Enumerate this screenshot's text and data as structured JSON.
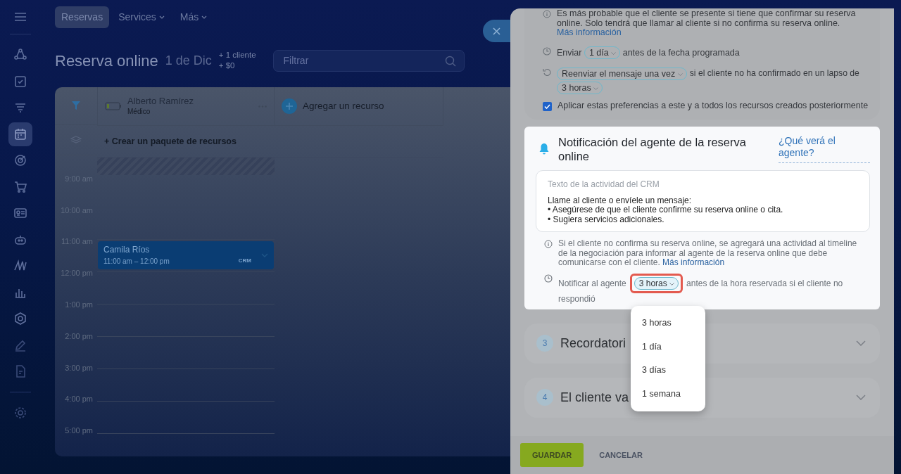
{
  "sidebar": {
    "items": [
      {
        "selected": false
      },
      {
        "selected": false
      },
      {
        "selected": false
      },
      {
        "selected": true
      },
      {
        "selected": false
      },
      {
        "selected": false
      },
      {
        "selected": false
      },
      {
        "selected": false
      },
      {
        "selected": false
      },
      {
        "selected": false
      },
      {
        "selected": false
      },
      {
        "selected": false
      },
      {
        "selected": false
      },
      {
        "selected": false
      }
    ]
  },
  "top_nav": [
    {
      "label": "Reservas",
      "selected": true,
      "has_menu": false
    },
    {
      "label": "Services",
      "selected": false,
      "has_menu": true
    },
    {
      "label": "Más",
      "selected": false,
      "has_menu": true
    }
  ],
  "header": {
    "title": "Reserva online",
    "date": "1 de Dic",
    "stats": [
      "+ 1 cliente",
      "+ $0"
    ],
    "filter": {
      "placeholder": "Filtrar"
    }
  },
  "calendar": {
    "resource": {
      "name": "Alberto Ramírez",
      "role": "Médico"
    },
    "add_resource": "Agregar un recurso",
    "create_package": "+ Crear un paquete de recursos",
    "times": [
      "9:00 am",
      "10:00 am",
      "11:00 am",
      "12:00 pm",
      "1:00 pm",
      "2:00 pm",
      "3:00 pm",
      "4:00 pm",
      "5:00 pm"
    ],
    "booking": {
      "client": "Camila Ríos",
      "time": "11:00 am – 12:00 pm",
      "tag": "CRM"
    }
  },
  "panel": {
    "confirm_section": {
      "info": "Es más probable que el cliente se presente si tiene que confirmar su reserva online. Solo tendrá que llamar al cliente si no confirma su reserva online.",
      "info_link": "Más información",
      "send": {
        "prefix": "Enviar",
        "value": "1 día",
        "suffix": "antes de la fecha programada"
      },
      "resend": {
        "value": "Reenviar el mensaje una vez",
        "suffix": "si el cliente no ha confirmado en un lapso de",
        "value2": "3 horas"
      },
      "apply": {
        "label": "Aplicar estas preferencias a este y a todos los recursos creados posteriormente",
        "checked": true
      }
    },
    "agent_notification": {
      "title": "Notificación del agente de la reserva online",
      "help_link": "¿Qué verá el agente?",
      "activity": {
        "label": "Texto de la actividad del CRM",
        "lines": [
          "Llame al cliente o envíele un mensaje:",
          "• Asegúrese de que el cliente confirme su reserva online o cita.",
          "• Sugiera servicios adicionales."
        ]
      },
      "info": "Si el cliente no confirma su reserva online, se agregará una actividad al timeline de la negociación para informar al agente de la reserva online que debe comunicarse con el cliente.",
      "info_link": "Más información",
      "notify": {
        "prefix": "Notificar al agente",
        "value": "3 horas",
        "suffix": "antes de la hora reservada si el cliente no respondió",
        "highlighted": true
      }
    },
    "dropdown": {
      "options": [
        "3 horas",
        "1 día",
        "3 días",
        "1 semana"
      ]
    },
    "sections": [
      {
        "number": "3",
        "title": "Recordatori",
        "expanded": false
      },
      {
        "number": "4",
        "title": "El cliente va",
        "expanded": false
      }
    ],
    "footer": {
      "buttons": [
        {
          "label": "GUARDAR",
          "kind": "primary"
        },
        {
          "label": "CANCELAR",
          "kind": "link"
        }
      ]
    }
  }
}
